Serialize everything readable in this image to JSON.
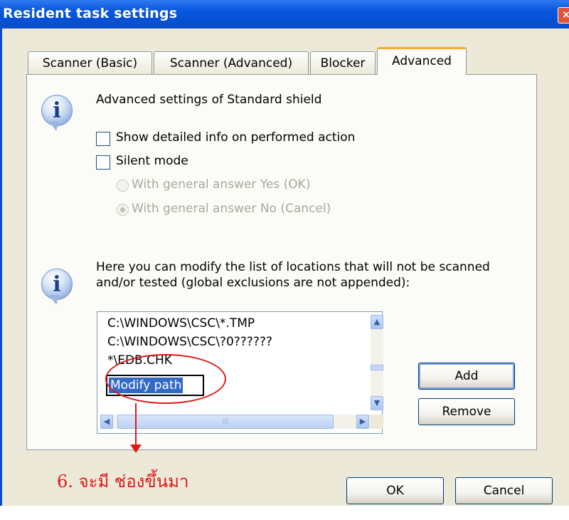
{
  "window": {
    "title": "Resident task settings",
    "close_glyph": "×"
  },
  "tabs": [
    {
      "label": "Scanner (Basic)",
      "active": false
    },
    {
      "label": "Scanner (Advanced)",
      "active": false
    },
    {
      "label": "Blocker",
      "active": false
    },
    {
      "label": "Advanced",
      "active": true
    }
  ],
  "section1": {
    "icon": "info-icon",
    "heading": "Advanced settings of Standard shield",
    "checkboxes": [
      {
        "label": "Show detailed info on performed action",
        "checked": false
      },
      {
        "label": "Silent mode",
        "checked": false
      }
    ],
    "radios": [
      {
        "label": "With general answer Yes (OK)",
        "selected": false,
        "enabled": false
      },
      {
        "label": "With general answer No (Cancel)",
        "selected": true,
        "enabled": false
      }
    ]
  },
  "section2": {
    "icon": "info-icon",
    "description_line1": "Here you can modify the list of locations that will not be scanned",
    "description_line2": "and/or tested (global exclusions are not appended):",
    "list_items": [
      "C:\\WINDOWS\\CSC\\*.TMP",
      "C:\\WINDOWS\\CSC\\?0??????",
      "*\\EDB.CHK"
    ],
    "edit_value": "Modify path",
    "add_label": "Add",
    "remove_label": "Remove"
  },
  "buttons": {
    "ok_label": "OK",
    "cancel_label": "Cancel"
  },
  "annotation": {
    "text": "6. จะมี ช่องขึ้นมา",
    "color": "#e01818"
  },
  "colors": {
    "titlebar": "#0a58e0",
    "dialog_bg": "#ece9d8",
    "active_tab_accent": "#f7a843",
    "selection": "#316ac5"
  }
}
